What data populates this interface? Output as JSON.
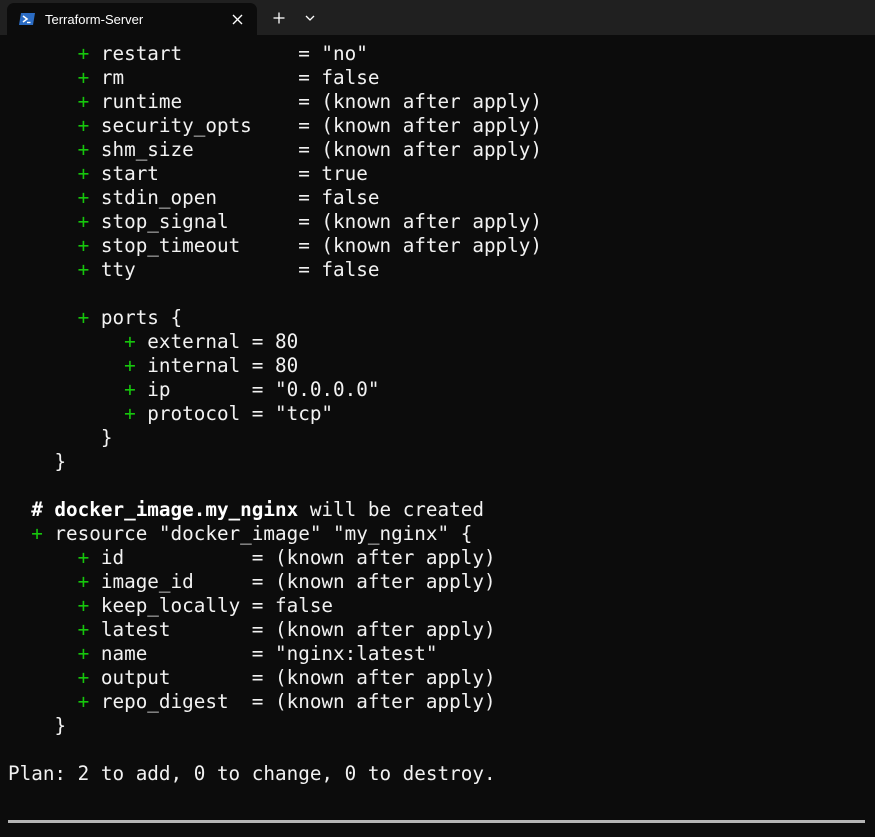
{
  "window": {
    "tab_title": "Terraform-Server",
    "new_tab_glyph": "+",
    "tab_icon": "powershell-icon",
    "colors": {
      "background": "#0c0c0c",
      "titlebar": "#202020",
      "green": "#16c60c",
      "text": "#cccccc"
    }
  },
  "terminal": {
    "lines": [
      {
        "indent": "      ",
        "mark": "+",
        "text": " restart          = \"no\""
      },
      {
        "indent": "      ",
        "mark": "+",
        "text": " rm               = false"
      },
      {
        "indent": "      ",
        "mark": "+",
        "text": " runtime          = (known after apply)"
      },
      {
        "indent": "      ",
        "mark": "+",
        "text": " security_opts    = (known after apply)"
      },
      {
        "indent": "      ",
        "mark": "+",
        "text": " shm_size         = (known after apply)"
      },
      {
        "indent": "      ",
        "mark": "+",
        "text": " start            = true"
      },
      {
        "indent": "      ",
        "mark": "+",
        "text": " stdin_open       = false"
      },
      {
        "indent": "      ",
        "mark": "+",
        "text": " stop_signal      = (known after apply)"
      },
      {
        "indent": "      ",
        "mark": "+",
        "text": " stop_timeout     = (known after apply)"
      },
      {
        "indent": "      ",
        "mark": "+",
        "text": " tty              = false"
      },
      {
        "indent": "",
        "mark": "",
        "text": ""
      },
      {
        "indent": "      ",
        "mark": "+",
        "text": " ports {"
      },
      {
        "indent": "          ",
        "mark": "+",
        "text": " external = 80"
      },
      {
        "indent": "          ",
        "mark": "+",
        "text": " internal = 80"
      },
      {
        "indent": "          ",
        "mark": "+",
        "text": " ip       = \"0.0.0.0\""
      },
      {
        "indent": "          ",
        "mark": "+",
        "text": " protocol = \"tcp\""
      },
      {
        "indent": "        ",
        "mark": "",
        "text": "}"
      },
      {
        "indent": "    ",
        "mark": "",
        "text": "}"
      },
      {
        "indent": "",
        "mark": "",
        "text": ""
      },
      {
        "indent": "  ",
        "mark": "",
        "bold": "# docker_image.my_nginx",
        "text": " will be created"
      },
      {
        "indent": "  ",
        "mark": "+",
        "text": " resource \"docker_image\" \"my_nginx\" {"
      },
      {
        "indent": "      ",
        "mark": "+",
        "text": " id           = (known after apply)"
      },
      {
        "indent": "      ",
        "mark": "+",
        "text": " image_id     = (known after apply)"
      },
      {
        "indent": "      ",
        "mark": "+",
        "text": " keep_locally = false"
      },
      {
        "indent": "      ",
        "mark": "+",
        "text": " latest       = (known after apply)"
      },
      {
        "indent": "      ",
        "mark": "+",
        "text": " name         = \"nginx:latest\""
      },
      {
        "indent": "      ",
        "mark": "+",
        "text": " output       = (known after apply)"
      },
      {
        "indent": "      ",
        "mark": "+",
        "text": " repo_digest  = (known after apply)"
      },
      {
        "indent": "    ",
        "mark": "",
        "text": "}"
      },
      {
        "indent": "",
        "mark": "",
        "text": ""
      },
      {
        "indent": "",
        "mark": "",
        "text": "Plan: 2 to add, 0 to change, 0 to destroy."
      }
    ]
  }
}
